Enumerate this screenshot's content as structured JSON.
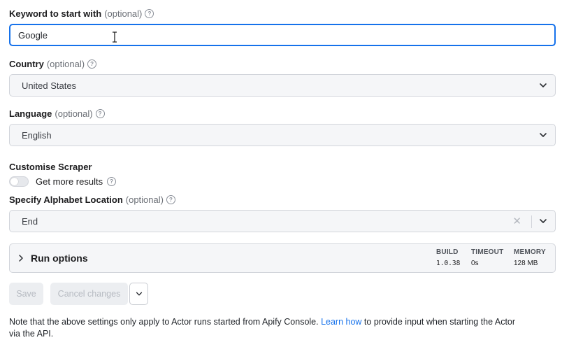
{
  "keyword": {
    "label": "Keyword to start with",
    "optional": "(optional)",
    "value": "Google"
  },
  "country": {
    "label": "Country",
    "optional": "(optional)",
    "value": "United States"
  },
  "language": {
    "label": "Language",
    "optional": "(optional)",
    "value": "English"
  },
  "customise": {
    "label": "Customise Scraper",
    "toggle_label": "Get more results",
    "toggle_on": false
  },
  "alphabet": {
    "label": "Specify Alphabet Location",
    "optional": "(optional)",
    "value": "End"
  },
  "run_options": {
    "title": "Run options",
    "build_label": "BUILD",
    "build_value": "1.0.38",
    "timeout_label": "TIMEOUT",
    "timeout_value": "0s",
    "memory_label": "MEMORY",
    "memory_value": "128 MB"
  },
  "actions": {
    "save": "Save",
    "cancel": "Cancel changes"
  },
  "note": {
    "before": "Note that the above settings only apply to Actor runs started from Apify Console. ",
    "link": "Learn how",
    "after": " to provide input when starting the Actor via the API."
  },
  "colors": {
    "accent": "#1672eb",
    "border": "#d2d5db",
    "select_bg": "#f5f6f8"
  }
}
